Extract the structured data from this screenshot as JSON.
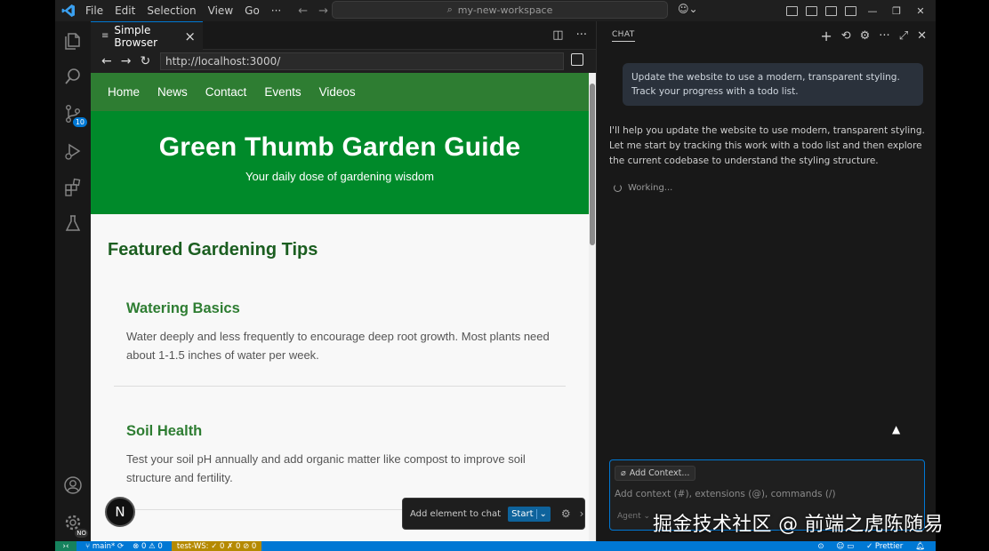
{
  "titlebar": {
    "menu": [
      "File",
      "Edit",
      "Selection",
      "View",
      "Go",
      "···"
    ],
    "search_text": "my-new-workspace"
  },
  "activity": {
    "source_control_badge": "10",
    "manage_badge": "NO"
  },
  "editor": {
    "tab_label": "Simple Browser",
    "url": "http://localhost:3000/"
  },
  "website": {
    "nav": [
      "Home",
      "News",
      "Contact",
      "Events",
      "Videos"
    ],
    "hero_title": "Green Thumb Garden Guide",
    "hero_subtitle": "Your daily dose of gardening wisdom",
    "featured_heading": "Featured Gardening Tips",
    "tips": [
      {
        "title": "Watering Basics",
        "text": "Water deeply and less frequently to encourage deep root growth. Most plants need about 1-1.5 inches of water per week."
      },
      {
        "title": "Soil Health",
        "text": "Test your soil pH annually and add organic matter like compost to improve soil structure and fertility."
      }
    ],
    "n_badge": "N"
  },
  "add_element": {
    "label": "Add element to chat",
    "start_label": "Start"
  },
  "chat": {
    "header": "CHAT",
    "user_message": "Update the website to use a modern, transparent styling. Track your progress with a todo list.",
    "ai_message": "I'll help you update the website to use modern, transparent styling. Let me start by tracking this work with a todo list and then explore the current codebase to understand the styling structure.",
    "working": "Working...",
    "add_context": "Add Context...",
    "input_placeholder": "Add context (#), extensions (@), commands (/)",
    "agent_label": "Agent"
  },
  "statusbar": {
    "branch": "main*",
    "problems": "⊗ 0 ⚠ 0",
    "test": "test-WS: ✓ 0 ✗ 0 ⊘ 0",
    "prettier": "✓ Prettier"
  },
  "watermark": "掘金技术社区 @ 前端之虎陈随易",
  "colors": {
    "accent": "#0078d4",
    "site_green": "#008a2a",
    "nav_green": "#2e7d32"
  }
}
